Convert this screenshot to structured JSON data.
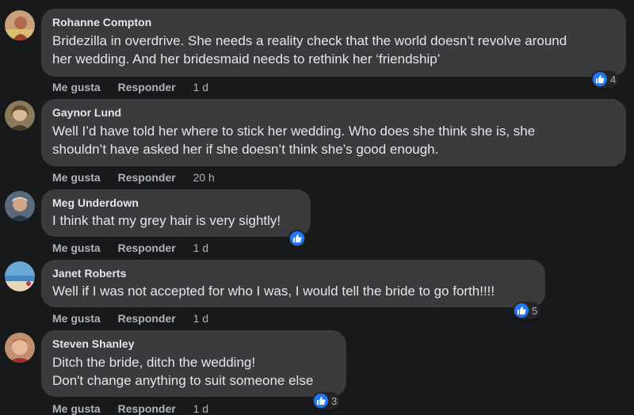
{
  "comments": [
    {
      "author": "Rohanne Compton",
      "text": "Bridezilla in overdrive. She needs a reality check that the world doesn’t revolve around\nher wedding. And her bridesmaid needs to rethink her ‘friendship’",
      "like_label": "Me gusta",
      "reply_label": "Responder",
      "time": "1 d",
      "reactions": "4"
    },
    {
      "author": "Gaynor Lund",
      "text": "Well I’d have told her where to stick her wedding. Who does she think she is, she\nshouldn’t have asked her if she doesn’t think she’s good enough.",
      "like_label": "Me gusta",
      "reply_label": "Responder",
      "time": "20 h",
      "reactions": ""
    },
    {
      "author": "Meg Underdown",
      "text": "I think that my grey hair is very sightly!",
      "like_label": "Me gusta",
      "reply_label": "Responder",
      "time": "1 d",
      "reactions": ""
    },
    {
      "author": "Janet Roberts",
      "text": "Well if I was not accepted for who I was, I would tell the bride to go forth!!!!",
      "like_label": "Me gusta",
      "reply_label": "Responder",
      "time": "1 d",
      "reactions": "5"
    },
    {
      "author": "Steven Shanley",
      "text": "Ditch the bride, ditch the wedding!\nDon't change anything to suit someone else",
      "like_label": "Me gusta",
      "reply_label": "Responder",
      "time": "1 d",
      "reactions": "3"
    }
  ],
  "colors": {
    "background": "#18191a",
    "bubble": "#3a3b3c",
    "like_blue": "#2078f4",
    "secondary_text": "#b0b3b8"
  },
  "icons": [
    "like-icon",
    "avatar"
  ]
}
